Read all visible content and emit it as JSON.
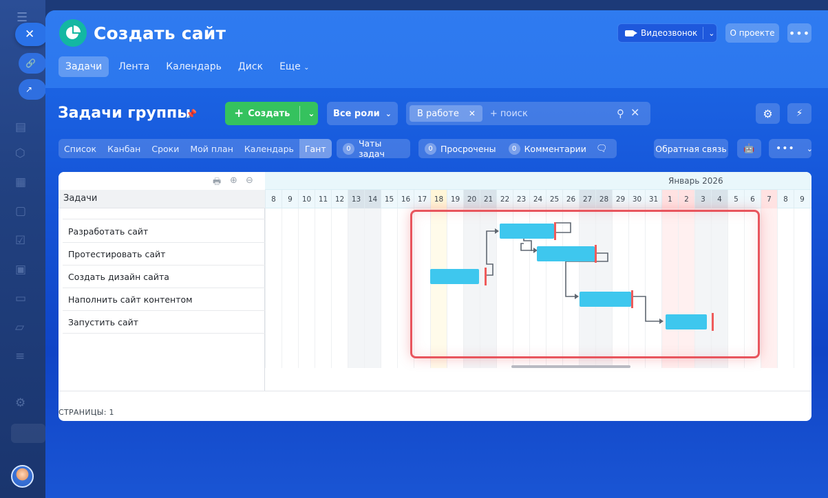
{
  "app": {
    "title": "Создать сайт",
    "videocall_label": "Видеозвонок",
    "about_label": "О проекте",
    "nav_tabs": [
      "Задачи",
      "Лента",
      "Календарь",
      "Диск",
      "Еще"
    ]
  },
  "toolbar": {
    "page_title": "Задачи группы",
    "create_label": "Создать",
    "roles_label": "Все роли",
    "filter_chip": "В работе",
    "search_placeholder": "+ поиск"
  },
  "views": {
    "items": [
      "Список",
      "Канбан",
      "Сроки",
      "Мой план",
      "Календарь",
      "Гант"
    ],
    "active": "Гант",
    "counters": {
      "chats": {
        "count": "0",
        "label": "Чаты задач"
      },
      "overdue": {
        "count": "0",
        "label": "Просрочены"
      },
      "comments": {
        "count": "0",
        "label": "Комментарии"
      }
    },
    "feedback_label": "Обратная связь"
  },
  "gantt": {
    "column_header": "Задачи",
    "tasks": [
      "Разработать сайт",
      "Протестировать сайт",
      "Создать дизайн сайта",
      "Наполнить сайт контентом",
      "Запустить сайт"
    ],
    "month_label": "Январь 2026",
    "days": [
      "8",
      "9",
      "10",
      "11",
      "12",
      "13",
      "14",
      "15",
      "16",
      "17",
      "18",
      "19",
      "20",
      "21",
      "22",
      "23",
      "24",
      "25",
      "26",
      "27",
      "28",
      "29",
      "30",
      "31",
      "1",
      "2",
      "3",
      "4",
      "5",
      "6",
      "7",
      "8",
      "9"
    ],
    "pages_label": "СТРАНИЦЫ: 1"
  },
  "icons": {
    "menu": "hamburger-icon",
    "close": "close-icon",
    "print": "printer-icon",
    "zoom_in": "zoom-in-icon",
    "zoom_out": "zoom-out-icon"
  },
  "colors": {
    "accent": "#2f7bf0",
    "create": "#35c25e",
    "bar": "#3ec7ee",
    "deadline": "#ef5b5b",
    "highlight": "#e8555d"
  }
}
